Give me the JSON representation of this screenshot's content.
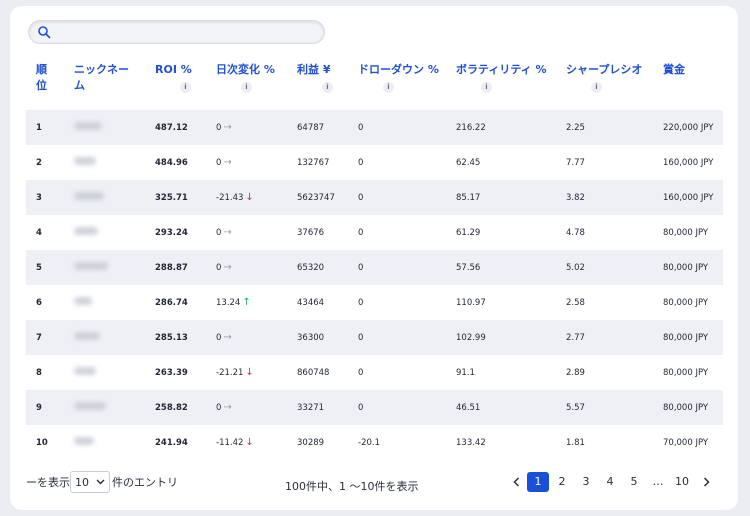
{
  "search": {
    "placeholder": ""
  },
  "headers": [
    {
      "label_line1": "順",
      "label_line2": "位",
      "info": false
    },
    {
      "label_line1": "ニックネー",
      "label_line2": "ム",
      "info": false
    },
    {
      "label_line1": "ROI %",
      "label_line2": "",
      "info": true
    },
    {
      "label_line1": "日次変化 %",
      "label_line2": "",
      "info": true
    },
    {
      "label_line1": "利益 ¥",
      "label_line2": "",
      "info": true
    },
    {
      "label_line1": "ドローダウン %",
      "label_line2": "",
      "info": true
    },
    {
      "label_line1": "ボラティリティ %",
      "label_line2": "",
      "info": true
    },
    {
      "label_line1": "シャープレシオ",
      "label_line2": "",
      "info": true
    },
    {
      "label_line1": "賞金",
      "label_line2": "",
      "info": false
    }
  ],
  "info_glyph": "i",
  "rows": [
    {
      "rank": "1",
      "roi": "487.12",
      "daily": "0",
      "trend": "flat",
      "profit": "64787",
      "drawdown": "0",
      "volatility": "216.22",
      "sharpe": "2.25",
      "prize": "220,000 JPY"
    },
    {
      "rank": "2",
      "roi": "484.96",
      "daily": "0",
      "trend": "flat",
      "profit": "132767",
      "drawdown": "0",
      "volatility": "62.45",
      "sharpe": "7.77",
      "prize": "160,000 JPY"
    },
    {
      "rank": "3",
      "roi": "325.71",
      "daily": "-21.43",
      "trend": "down",
      "profit": "5623747",
      "drawdown": "0",
      "volatility": "85.17",
      "sharpe": "3.82",
      "prize": "160,000 JPY"
    },
    {
      "rank": "4",
      "roi": "293.24",
      "daily": "0",
      "trend": "flat",
      "profit": "37676",
      "drawdown": "0",
      "volatility": "61.29",
      "sharpe": "4.78",
      "prize": "80,000 JPY"
    },
    {
      "rank": "5",
      "roi": "288.87",
      "daily": "0",
      "trend": "flat",
      "profit": "65320",
      "drawdown": "0",
      "volatility": "57.56",
      "sharpe": "5.02",
      "prize": "80,000 JPY"
    },
    {
      "rank": "6",
      "roi": "286.74",
      "daily": "13.24",
      "trend": "up",
      "profit": "43464",
      "drawdown": "0",
      "volatility": "110.97",
      "sharpe": "2.58",
      "prize": "80,000 JPY"
    },
    {
      "rank": "7",
      "roi": "285.13",
      "daily": "0",
      "trend": "flat",
      "profit": "36300",
      "drawdown": "0",
      "volatility": "102.99",
      "sharpe": "2.77",
      "prize": "80,000 JPY"
    },
    {
      "rank": "8",
      "roi": "263.39",
      "daily": "-21.21",
      "trend": "down",
      "profit": "860748",
      "drawdown": "0",
      "volatility": "91.1",
      "sharpe": "2.89",
      "prize": "80,000 JPY"
    },
    {
      "rank": "9",
      "roi": "258.82",
      "daily": "0",
      "trend": "flat",
      "profit": "33271",
      "drawdown": "0",
      "volatility": "46.51",
      "sharpe": "5.57",
      "prize": "80,000 JPY"
    },
    {
      "rank": "10",
      "roi": "241.94",
      "daily": "-11.42",
      "trend": "down",
      "profit": "30289",
      "drawdown": "-20.1",
      "volatility": "133.42",
      "sharpe": "1.81",
      "prize": "70,000 JPY"
    }
  ],
  "arrows": {
    "flat": "→",
    "down": "↓",
    "up": "↑"
  },
  "footer": {
    "show_prefix": "ーを表示",
    "page_size": "10",
    "show_suffix": "件のエントリ",
    "info": "100件中、1 ～10件を表示",
    "pages": [
      "1",
      "2",
      "3",
      "4",
      "5",
      "…",
      "10"
    ],
    "active_page": "1"
  },
  "colors": {
    "accent": "#1a50d8",
    "header_text": "#1f4fd6",
    "down": "#d23a3a",
    "up": "#1eae6a"
  }
}
